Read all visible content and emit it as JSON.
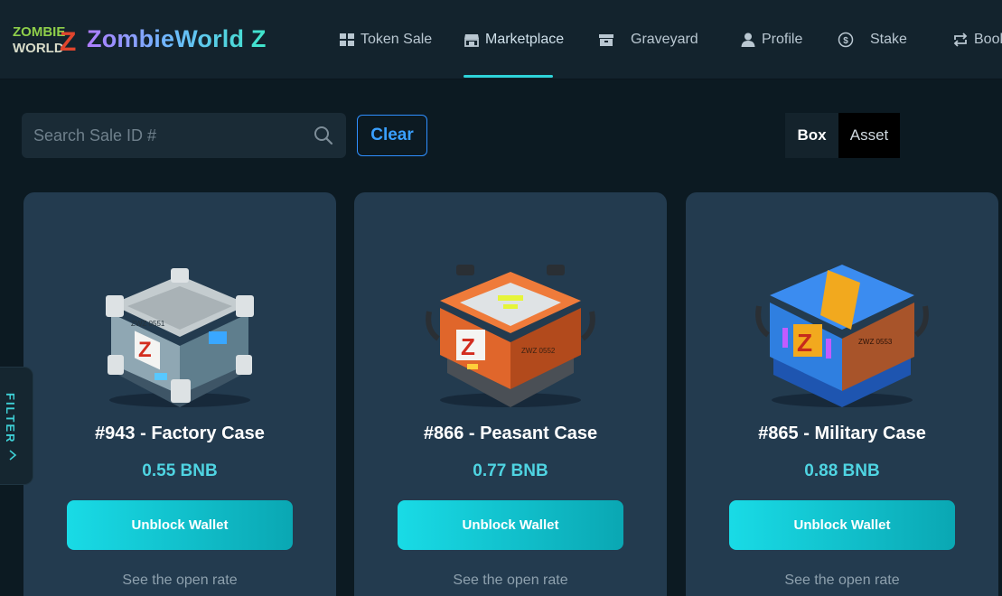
{
  "brand": {
    "logo_text": "ZOMBIE WORLD Z",
    "name": "ZombieWorld Z"
  },
  "nav": {
    "items": [
      {
        "label": "Token Sale",
        "icon": "grid-icon"
      },
      {
        "label": "Marketplace",
        "icon": "store-icon",
        "active": true
      },
      {
        "label": "Graveyard",
        "icon": "box-icon"
      },
      {
        "label": "Profile",
        "icon": "user-icon"
      },
      {
        "label": "Stake",
        "icon": "dollar-coin-icon"
      },
      {
        "label": "Book",
        "icon": "repeat-icon"
      }
    ]
  },
  "toolbar": {
    "search_placeholder": "Search Sale ID #",
    "search_value": "",
    "clear_label": "Clear",
    "toggle": {
      "box_label": "Box",
      "asset_label": "Asset",
      "selected": "Box"
    }
  },
  "filter": {
    "label": "FILTER",
    "icon": "chevron-right-icon"
  },
  "cards": [
    {
      "title": "#943 - Factory Case",
      "price": "0.55 BNB",
      "button_label": "Unblock Wallet",
      "link_label": "See the open rate",
      "box_code": "ZWZ 0551",
      "theme": "#9aa7ad"
    },
    {
      "title": "#866 - Peasant Case",
      "price": "0.77 BNB",
      "button_label": "Unblock Wallet",
      "link_label": "See the open rate",
      "box_code": "ZWZ 0552",
      "theme": "#e3662a"
    },
    {
      "title": "#865 - Military Case",
      "price": "0.88 BNB",
      "button_label": "Unblock Wallet",
      "link_label": "See the open rate",
      "box_code": "ZWZ 0553",
      "theme": "#2f7fe0"
    }
  ],
  "colors": {
    "accent": "#2ed3d9",
    "price": "#4fd4e2",
    "card_bg": "#233b4f",
    "page_bg": "#0c1a22",
    "button_start": "#19dbe6",
    "button_end": "#0aa7b3"
  }
}
